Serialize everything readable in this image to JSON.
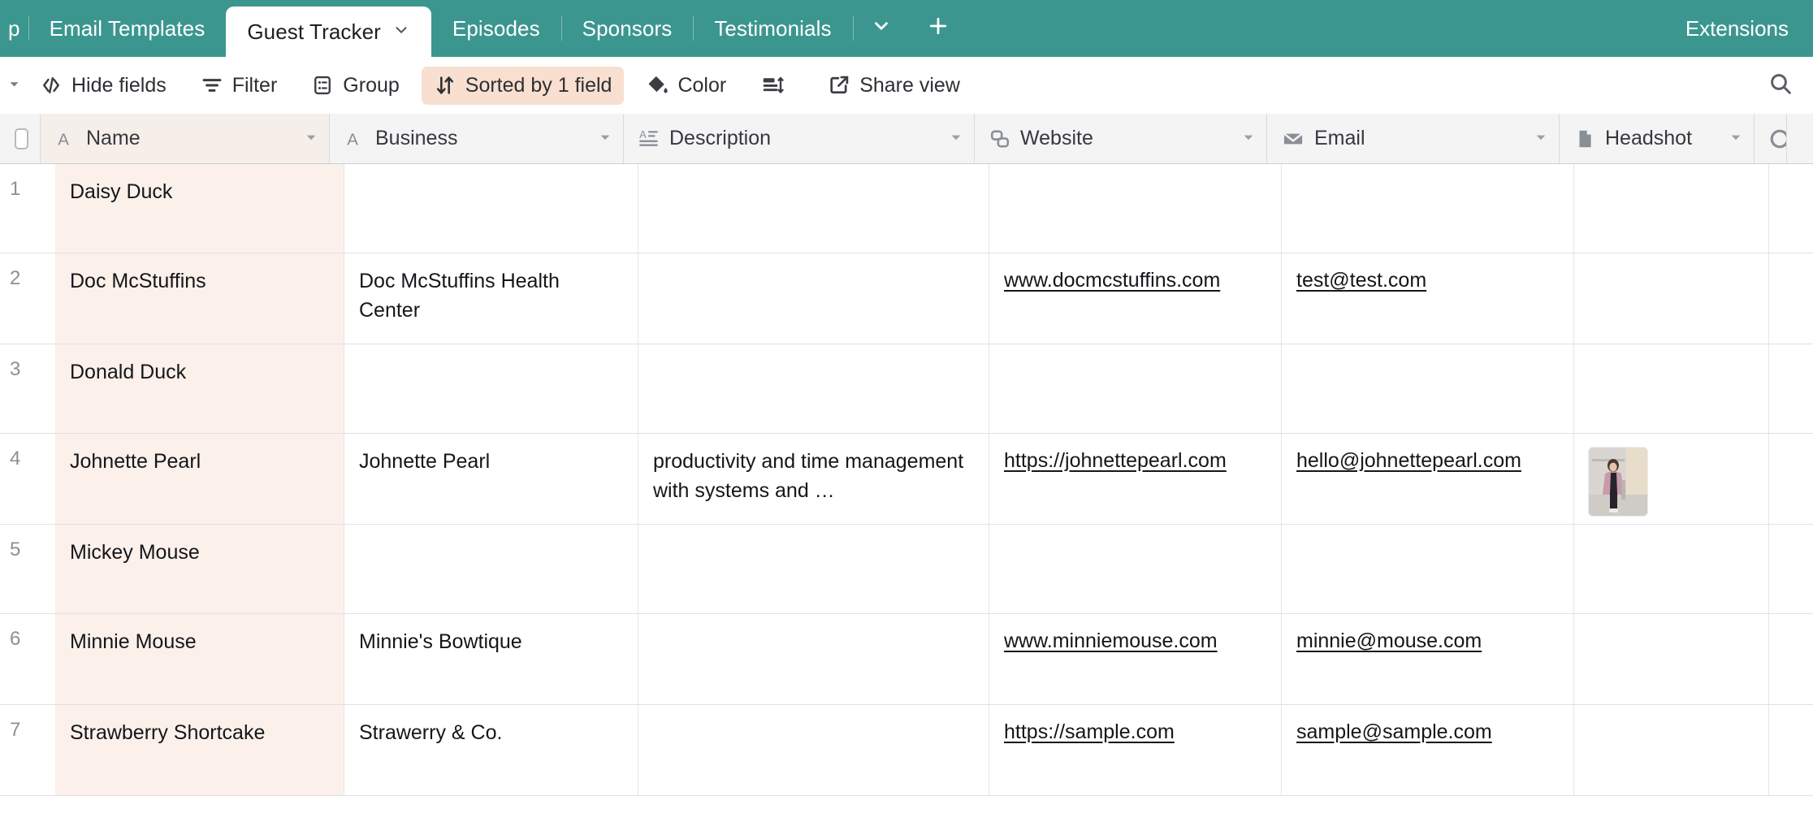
{
  "tabbar": {
    "partial_tab_label": "p",
    "tabs": [
      {
        "label": "Email Templates",
        "active": false
      },
      {
        "label": "Guest Tracker",
        "active": true,
        "caret": "chevron-down-icon"
      },
      {
        "label": "Episodes",
        "active": false
      },
      {
        "label": "Sponsors",
        "active": false
      },
      {
        "label": "Testimonials",
        "active": false
      }
    ],
    "overflow_caret": "⌄",
    "add_tab": "+",
    "extensions_label": "Extensions",
    "background_color": "#3c9690"
  },
  "toolbar": {
    "collapse_caret": "▾",
    "items": [
      {
        "label": "Hide fields",
        "icon": "hide-fields-icon",
        "highlight": false
      },
      {
        "label": "Filter",
        "icon": "filter-icon",
        "highlight": false
      },
      {
        "label": "Group",
        "icon": "group-icon",
        "highlight": false
      },
      {
        "label": "Sorted by 1 field",
        "icon": "sort-icon",
        "highlight": true
      },
      {
        "label": "Color",
        "icon": "color-icon",
        "highlight": false
      },
      {
        "label": "",
        "icon": "row-height-icon",
        "highlight": false
      },
      {
        "label": "Share view",
        "icon": "share-icon",
        "highlight": false
      }
    ],
    "search_icon": "search-icon",
    "highlight_color": "#f8dfd0"
  },
  "grid": {
    "columns": [
      {
        "key": "name",
        "label": "Name",
        "icon": "single-line-text-icon"
      },
      {
        "key": "business",
        "label": "Business",
        "icon": "single-line-text-icon"
      },
      {
        "key": "description",
        "label": "Description",
        "icon": "long-text-icon"
      },
      {
        "key": "website",
        "label": "Website",
        "icon": "url-link-icon"
      },
      {
        "key": "email",
        "label": "Email",
        "icon": "email-envelope-icon"
      },
      {
        "key": "headshot",
        "label": "Headshot",
        "icon": "attachment-file-icon"
      }
    ],
    "primary_field_bg": "#fcf0ea",
    "rows": [
      {
        "num": "1",
        "name": "Daisy Duck",
        "business": "",
        "description": "",
        "website": "",
        "email": "",
        "headshot": "",
        "tag_color": ""
      },
      {
        "num": "2",
        "name": "Doc McStuffins",
        "business": "Doc McStuffins Health Center",
        "description": "",
        "website": "www.docmcstuffins.com",
        "email": "test@test.com",
        "headshot": "",
        "tag_color": "#f7dde4"
      },
      {
        "num": "3",
        "name": "Donald Duck",
        "business": "",
        "description": "",
        "website": "",
        "email": "",
        "headshot": "",
        "tag_color": ""
      },
      {
        "num": "4",
        "name": "Johnette Pearl",
        "business": "Johnette Pearl",
        "description": "productivity and time management with systems and …",
        "website": "https://johnettepearl.com",
        "email": "hello@johnettepearl.com",
        "headshot": "headshot-thumbnail",
        "tag_color": "#f7dde4"
      },
      {
        "num": "5",
        "name": "Mickey Mouse",
        "business": "",
        "description": "",
        "website": "",
        "email": "",
        "headshot": "",
        "tag_color": ""
      },
      {
        "num": "6",
        "name": "Minnie Mouse",
        "business": "Minnie's Bowtique",
        "description": "",
        "website": "www.minniemouse.com",
        "email": "minnie@mouse.com",
        "headshot": "",
        "tag_color": "#fae6b8"
      },
      {
        "num": "7",
        "name": "Strawberry Shortcake",
        "business": "Strawerry & Co.",
        "description": "",
        "website": "https://sample.com",
        "email": "sample@sample.com",
        "headshot": "",
        "tag_color": "#d5efc2"
      }
    ]
  }
}
